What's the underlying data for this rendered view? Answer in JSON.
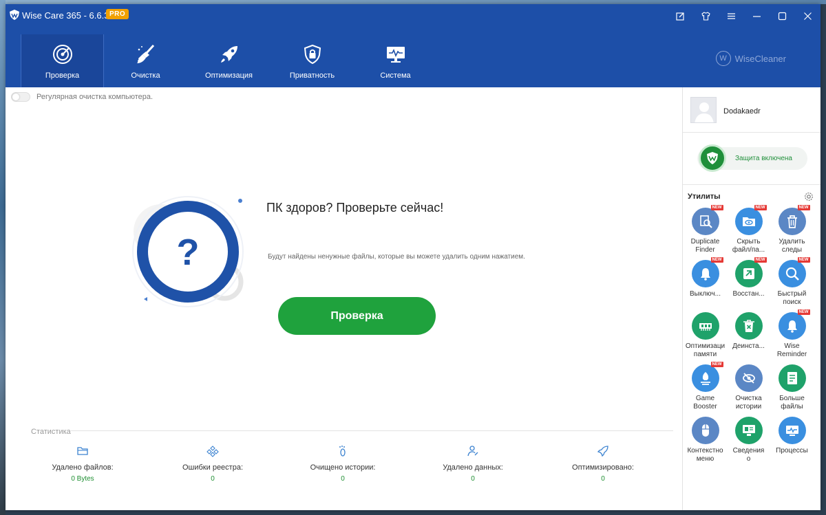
{
  "window": {
    "app_title": "Wise Care 365 - 6.6.3",
    "pro_badge": "PRO",
    "brand": "WiseCleaner",
    "brand_initial": "W"
  },
  "nav": {
    "tabs": [
      {
        "label": "Проверка",
        "icon": "radar-icon",
        "active": true
      },
      {
        "label": "Очистка",
        "icon": "broom-icon"
      },
      {
        "label": "Оптимизация",
        "icon": "rocket-icon"
      },
      {
        "label": "Приватность",
        "icon": "lock-shield-icon"
      },
      {
        "label": "Система",
        "icon": "monitor-icon"
      }
    ]
  },
  "main": {
    "regular_cleaning_label": "Регулярная очистка компьютера.",
    "hero_title": "ПК здоров? Проверьте сейчас!",
    "hero_desc": "Будут найдены ненужные файлы, которые вы можете удалить одним нажатием.",
    "hero_symbol": "?",
    "scan_button": "Проверка",
    "stats_title": "Статистика",
    "stats": [
      {
        "label": "Удалено файлов:",
        "value": "0 Bytes",
        "icon": "folder-icon"
      },
      {
        "label": "Ошибки реестра:",
        "value": "0",
        "icon": "registry-icon"
      },
      {
        "label": "Очищено истории:",
        "value": "0",
        "icon": "footprint-icon"
      },
      {
        "label": "Удалено данных:",
        "value": "0",
        "icon": "user-data-icon"
      },
      {
        "label": "Оптимизировано:",
        "value": "0",
        "icon": "rocket-small-icon"
      }
    ]
  },
  "side": {
    "user_name": "Dodakaedr",
    "protection_label": "Защита включена",
    "utils_title": "Утилиты",
    "new_label": "NEW",
    "tools": [
      {
        "label": "Duplicate\nFinder",
        "color": "#5b87c5",
        "new": true,
        "icon": "duplicate-finder-icon"
      },
      {
        "label": "Скрыть\nфайл/па...",
        "color": "#3a8fe0",
        "new": true,
        "icon": "hide-file-icon"
      },
      {
        "label": "Удалить\nследы",
        "color": "#5b87c5",
        "new": true,
        "icon": "trash-icon"
      },
      {
        "label": "Выключ...",
        "color": "#3a8fe0",
        "new": true,
        "icon": "bell-icon"
      },
      {
        "label": "Восстан...",
        "color": "#1fa26a",
        "new": true,
        "icon": "restore-icon"
      },
      {
        "label": "Быстрый\nпоиск",
        "color": "#3a8fe0",
        "new": true,
        "icon": "search-icon"
      },
      {
        "label": "Оптимизаци\nпамяти",
        "color": "#1fa26a",
        "new": false,
        "icon": "memory-icon"
      },
      {
        "label": "Деинста...",
        "color": "#1fa26a",
        "new": false,
        "icon": "uninstall-icon"
      },
      {
        "label": "Wise\nReminder",
        "color": "#3a8fe0",
        "new": true,
        "icon": "reminder-icon"
      },
      {
        "label": "Game\nBooster",
        "color": "#3a8fe0",
        "new": true,
        "icon": "game-booster-icon"
      },
      {
        "label": "Очистка\nистории",
        "color": "#5b87c5",
        "new": false,
        "icon": "eye-off-icon"
      },
      {
        "label": "Больше\nфайлы",
        "color": "#1fa26a",
        "new": false,
        "icon": "big-files-icon"
      },
      {
        "label": "Контекстно\nменю",
        "color": "#5b87c5",
        "new": false,
        "icon": "mouse-icon"
      },
      {
        "label": "Сведения\nо",
        "color": "#1fa26a",
        "new": false,
        "icon": "system-info-icon"
      },
      {
        "label": "Процессы",
        "color": "#3a8fe0",
        "new": false,
        "icon": "process-icon"
      }
    ]
  }
}
